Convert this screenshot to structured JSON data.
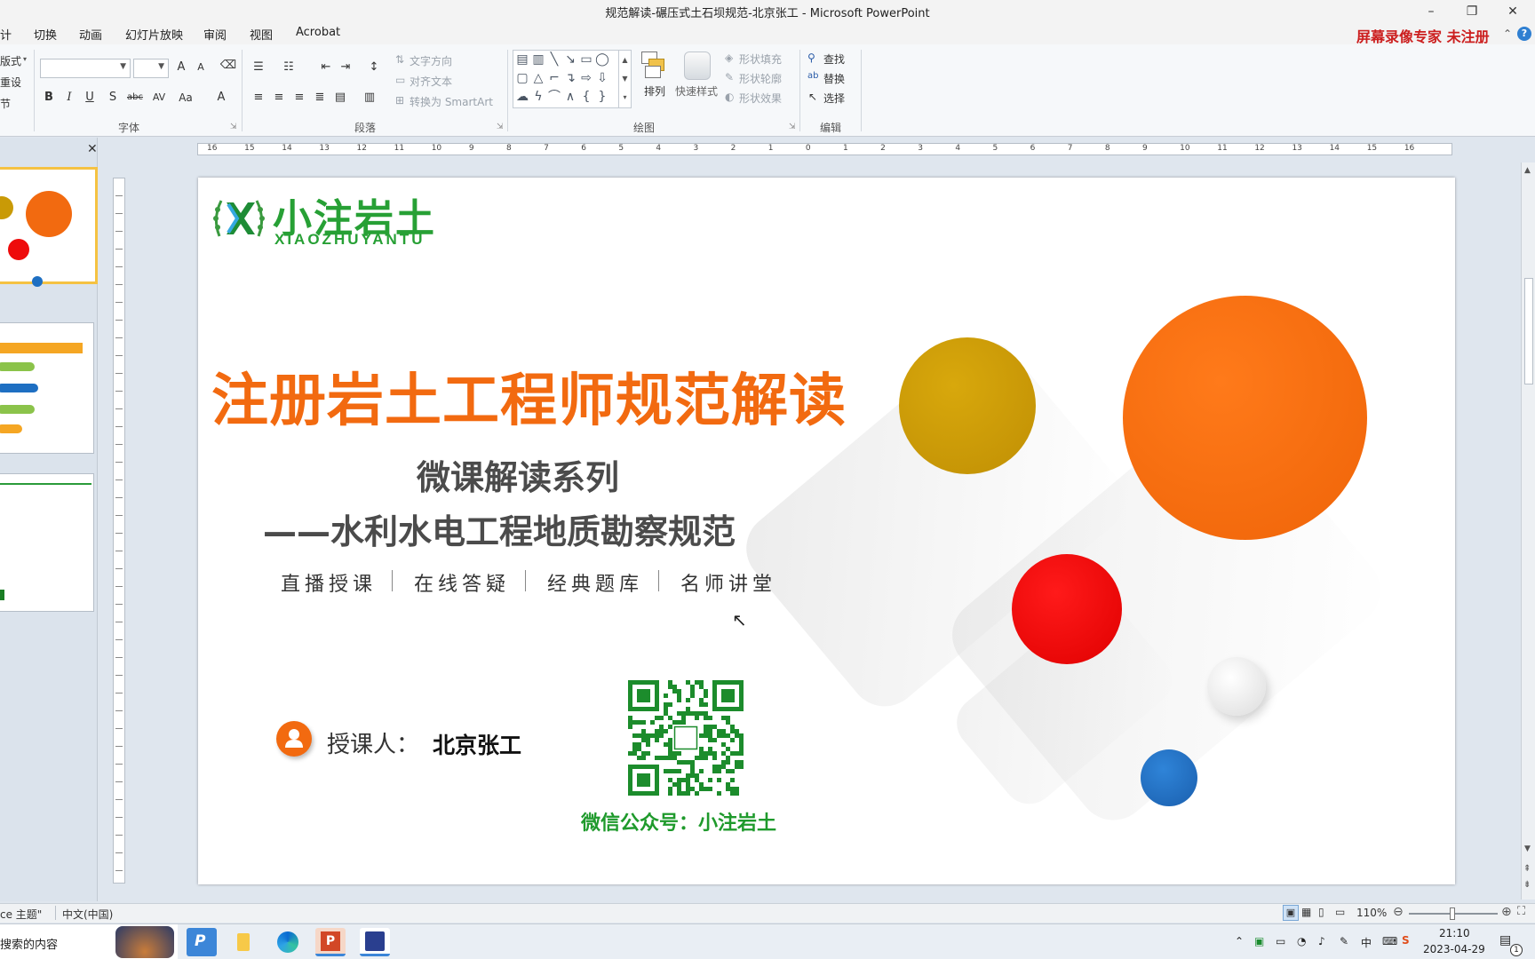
{
  "window": {
    "title": "规范解读-碾压式土石坝规范-北京张工  -  Microsoft PowerPoint",
    "minimize": "–",
    "restore": "❐",
    "close": "✕"
  },
  "tabs": [
    "计",
    "切换",
    "动画",
    "幻灯片放映",
    "审阅",
    "视图",
    "Acrobat"
  ],
  "promo": {
    "text": "屏幕录像专家  未注册",
    "caret": "⌃",
    "help": "?"
  },
  "ribbon": {
    "slides_group": {
      "layout": "版式",
      "reset": "重设",
      "section": "节"
    },
    "font_group": {
      "label": "字体",
      "bold": "B",
      "italic": "I",
      "underline": "U",
      "shadow": "S",
      "strike": "abc",
      "spacing": "AV",
      "case": "Aa",
      "color": "A",
      "grow": "A",
      "shrink": "A"
    },
    "paragraph_group": {
      "label": "段落",
      "text_direction": "文字方向",
      "align_text": "对齐文本",
      "smartart": "转换为 SmartArt"
    },
    "drawing_group": {
      "label": "绘图",
      "arrange": "排列",
      "quick_styles": "快速样式",
      "shape_fill": "形状填充",
      "shape_outline": "形状轮廓",
      "shape_effects": "形状效果"
    },
    "editing_group": {
      "label": "编辑",
      "find": "查找",
      "replace": "替换",
      "select": "选择"
    }
  },
  "ruler": {
    "h_ticks": [
      "16",
      "15",
      "14",
      "13",
      "12",
      "11",
      "10",
      "9",
      "8",
      "7",
      "6",
      "5",
      "4",
      "3",
      "2",
      "1",
      "0",
      "1",
      "2",
      "3",
      "4",
      "5",
      "6",
      "7",
      "8",
      "9",
      "10",
      "11",
      "12",
      "13",
      "14",
      "15",
      "16"
    ]
  },
  "panel": {
    "close": "✕"
  },
  "slide": {
    "logo_cn": "小注岩土",
    "logo_en": "XIAOZHUYANTU",
    "main_title": "注册岩土工程师规范解读",
    "subtitle1": "微课解读系列",
    "subtitle2": "——水利水电工程地质勘察规范",
    "features": [
      "直播授课",
      "在线答疑",
      "经典题库",
      "名师讲堂"
    ],
    "lecturer_label": "授课人：",
    "lecturer_name": "北京张工",
    "wechat": "微信公众号：小注岩土",
    "colors": {
      "orange": "#f26a10",
      "gold": "#c99a06",
      "red": "#ee0b0b",
      "blue": "#1e6fc2",
      "green": "#27a035"
    }
  },
  "status": {
    "theme": "ce 主题\"",
    "language": "中文(中国)",
    "zoom": "110%"
  },
  "taskbar": {
    "search": "搜索的内容",
    "time": "21:10",
    "date": "2023-04-29",
    "notif": "1"
  }
}
